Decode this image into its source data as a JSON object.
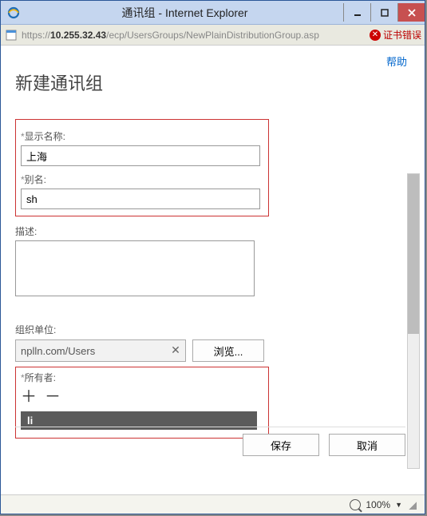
{
  "window": {
    "title": "通讯组 - Internet Explorer"
  },
  "addressbar": {
    "scheme": "https://",
    "host": "10.255.32.43",
    "path": "/ecp/UsersGroups/NewPlainDistributionGroup.asp",
    "cert_error": "证书错误"
  },
  "page": {
    "help": "帮助",
    "title": "新建通讯组"
  },
  "form": {
    "display_name_label": "显示名称:",
    "display_name_value": "上海",
    "alias_label": "别名:",
    "alias_value": "sh",
    "description_label": "描述:",
    "description_value": "",
    "ou_label": "组织单位:",
    "ou_value": "nplln.com/Users",
    "browse_label": "浏览...",
    "owners_label": "所有者:",
    "owners": [
      "li"
    ]
  },
  "buttons": {
    "save": "保存",
    "cancel": "取消"
  },
  "statusbar": {
    "zoom": "100%"
  }
}
